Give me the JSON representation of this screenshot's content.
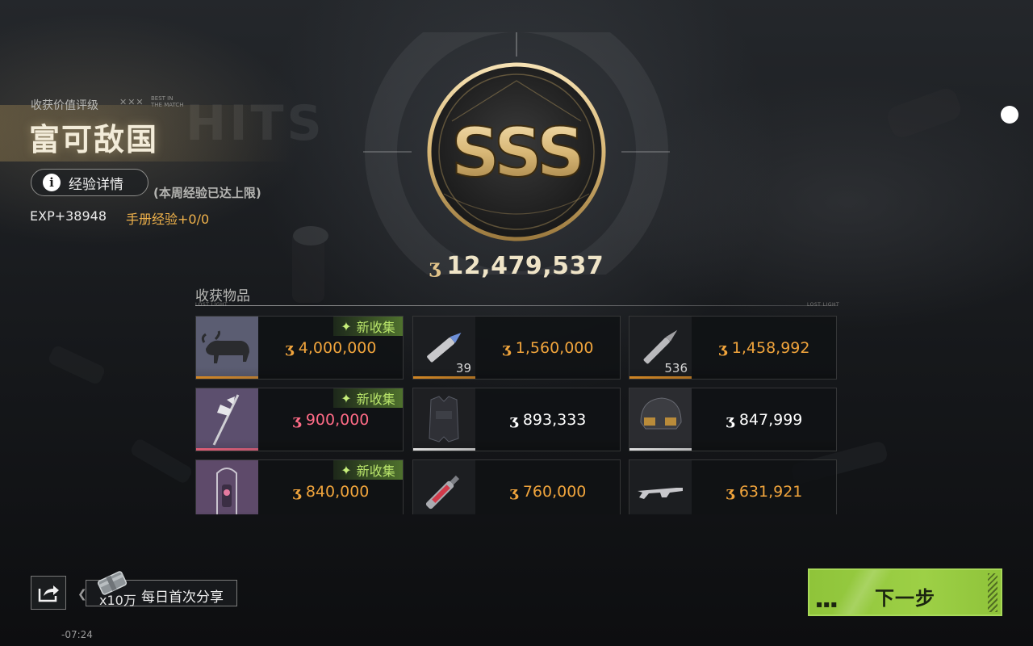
{
  "header": {
    "rating_caption": "收获价值评级",
    "rating_title": "富可敌国",
    "rating_mini_icon": "✕✕✕",
    "rating_mini_sub_1": "BEST IN",
    "rating_mini_sub_2": "THE MATCH",
    "exp_detail_label": "经验详情",
    "info_icon_glyph": "i",
    "exp_cap_note": "(本周经验已达上限)",
    "exp_value": "EXP+38948",
    "manual_exp": "手册经验+0/0"
  },
  "emblem": {
    "grade": "SSS"
  },
  "total": {
    "coin_icon": "coin-icon",
    "coin_glyph": "ʒ",
    "value": "12,479,537"
  },
  "items_section": {
    "title": "收获物品",
    "divider_tag_left": "LOST LIGHT",
    "divider_tag_right": "LOST LIGHT",
    "new_label": "新收集",
    "new_glyph": "✦",
    "items": [
      {
        "name": "bronze-ox-statue",
        "price": "4,000,000",
        "count": "",
        "new": true,
        "price_color": "#f0a43c",
        "bar_color": "#f09a2a"
      },
      {
        "name": "blue-tip-bullet",
        "price": "1,560,000",
        "count": "39",
        "new": false,
        "price_color": "#f0a43c",
        "bar_color": "#f09a2a"
      },
      {
        "name": "rifle-bullet",
        "price": "1,458,992",
        "count": "536",
        "new": false,
        "price_color": "#f0a43c",
        "bar_color": "#f09a2a"
      },
      {
        "name": "ornate-halberd",
        "price": "900,000",
        "count": "",
        "new": true,
        "price_color": "#ff6b86",
        "bar_color": "#ff6b86"
      },
      {
        "name": "tactical-armor-vest",
        "price": "893,333",
        "count": "",
        "new": false,
        "price_color": "#ffffff",
        "bar_color": "#ffffff"
      },
      {
        "name": "tactical-helmet",
        "price": "847,999",
        "count": "",
        "new": false,
        "price_color": "#ffffff",
        "bar_color": "#ffffff"
      },
      {
        "name": "caged-lantern",
        "price": "840,000",
        "count": "",
        "new": true,
        "price_color": "#f0a43c",
        "bar_color": "#f09a2a"
      },
      {
        "name": "red-injector",
        "price": "760,000",
        "count": "",
        "new": false,
        "price_color": "#f0a43c",
        "bar_color": "#f09a2a"
      },
      {
        "name": "assault-rifle",
        "price": "631,921",
        "count": "",
        "new": false,
        "price_color": "#f0a43c",
        "bar_color": "#f09a2a"
      }
    ]
  },
  "bottom": {
    "share_icon": "share-icon",
    "reward_count": "x10万",
    "reward_label": "每日首次分享",
    "timer": "-07:24",
    "next_label": "下一步",
    "next_dots": "▪▪▪"
  },
  "colors": {
    "accent_green": "#9dd046",
    "gold": "#e2c48a",
    "orange_price": "#f0a43c",
    "pink_price": "#ff6b86",
    "new_tag_text": "#b8e46a"
  }
}
